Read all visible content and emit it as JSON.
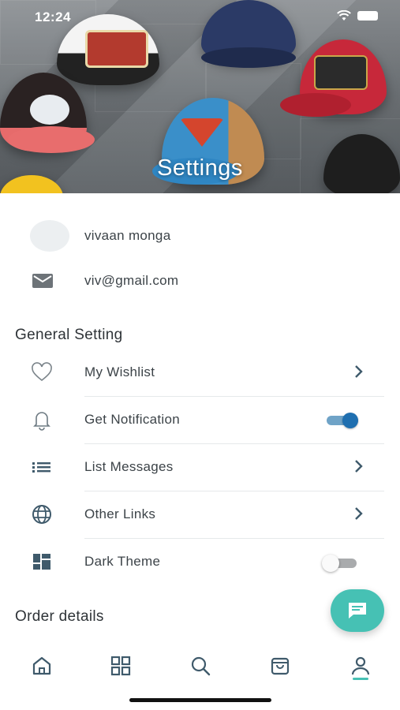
{
  "status_bar": {
    "time": "12:24"
  },
  "header": {
    "title": "Settings"
  },
  "profile": {
    "name": "vivaan monga",
    "email": "viv@gmail.com"
  },
  "general_setting": {
    "title": "General Setting",
    "items": [
      {
        "label": "My Wishlist",
        "icon": "heart-icon",
        "control": "chevron"
      },
      {
        "label": "Get Notification",
        "icon": "bell-icon",
        "control": "toggle",
        "enabled": true
      },
      {
        "label": "List Messages",
        "icon": "list-icon",
        "control": "chevron"
      },
      {
        "label": "Other Links",
        "icon": "globe-icon",
        "control": "chevron"
      },
      {
        "label": "Dark Theme",
        "icon": "dashboard-icon",
        "control": "toggle",
        "enabled": false
      }
    ]
  },
  "order_details": {
    "title": "Order details"
  },
  "fab": {
    "icon": "chat-icon"
  },
  "bottom_nav": [
    {
      "icon": "home-icon"
    },
    {
      "icon": "grid-icon"
    },
    {
      "icon": "search-icon"
    },
    {
      "icon": "bag-icon"
    },
    {
      "icon": "profile-icon",
      "active": true
    }
  ],
  "colors": {
    "accent": "#46c1b4",
    "toggle_on": "#1f6fb0",
    "icon": "#3f5a6b"
  }
}
